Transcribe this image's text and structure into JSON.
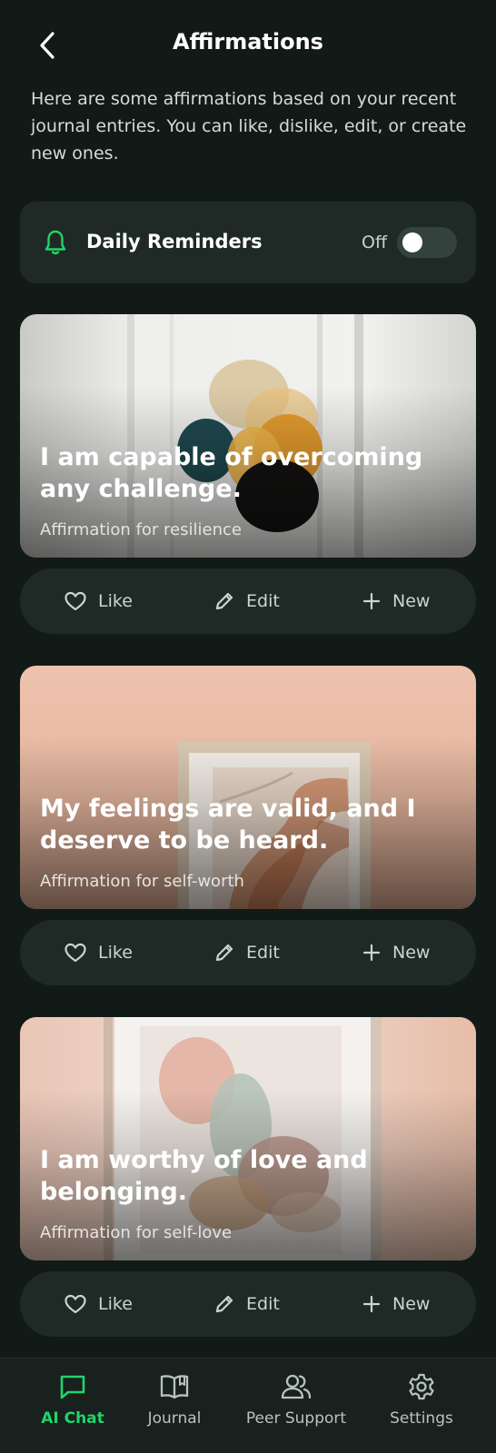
{
  "header": {
    "title": "Affirmations",
    "back_icon": "chevron-left-icon"
  },
  "intro": "Here are some affirmations based on your recent journal entries. You can like, dislike, edit, or create new ones.",
  "reminder": {
    "label": "Daily Reminders",
    "state_label": "Off",
    "enabled": false,
    "icon": "bell-icon",
    "icon_color": "#22d36a"
  },
  "actions": {
    "like_label": "Like",
    "edit_label": "Edit",
    "new_label": "New"
  },
  "affirmations": [
    {
      "quote": "I am capable of overcoming any challenge.",
      "category": "Affirmation for resilience"
    },
    {
      "quote": "My feelings are valid, and I deserve to be heard.",
      "category": "Affirmation for self-worth"
    },
    {
      "quote": "I am worthy of love and belonging.",
      "category": "Affirmation for self-love"
    }
  ],
  "tabs": [
    {
      "label": "AI Chat",
      "icon": "chat-bubble-icon",
      "active": true
    },
    {
      "label": "Journal",
      "icon": "open-book-icon",
      "active": false
    },
    {
      "label": "Peer Support",
      "icon": "users-icon",
      "active": false
    },
    {
      "label": "Settings",
      "icon": "gear-icon",
      "active": false
    }
  ],
  "colors": {
    "background": "#121a17",
    "surface": "#1f2a26",
    "accent": "#22d36a"
  }
}
